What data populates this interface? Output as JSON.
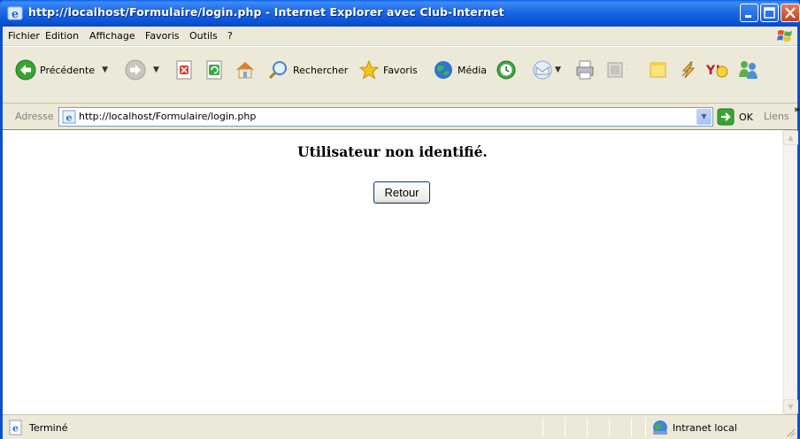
{
  "window": {
    "title": "http://localhost/Formulaire/login.php - Internet Explorer avec Club-Internet",
    "title_icon": "ie-logo-icon",
    "controls": [
      "minimize-icon",
      "maximize-icon",
      "close-icon"
    ]
  },
  "menubar": {
    "items": [
      {
        "label": "Fichier"
      },
      {
        "label": "Edition"
      },
      {
        "label": "Affichage"
      },
      {
        "label": "Favoris"
      },
      {
        "label": "Outils"
      },
      {
        "label": "?"
      }
    ]
  },
  "toolbar": {
    "back_label": "Précédente",
    "search_label": "Rechercher",
    "favorites_label": "Favoris",
    "media_label": "Média"
  },
  "address": {
    "label": "Adresse",
    "url": "http://localhost/Formulaire/login.php",
    "go_label": "OK",
    "links_label": "Liens",
    "chevron": "»"
  },
  "page": {
    "message": "Utilisateur non identifié.",
    "button_label": "Retour"
  },
  "status": {
    "text": "Terminé",
    "zone": "Intranet local"
  },
  "colors": {
    "titlebar": "#0a5ce8",
    "chrome": "#ece9d8",
    "content_bg": "#ffffff",
    "button_border": "#003c74"
  }
}
